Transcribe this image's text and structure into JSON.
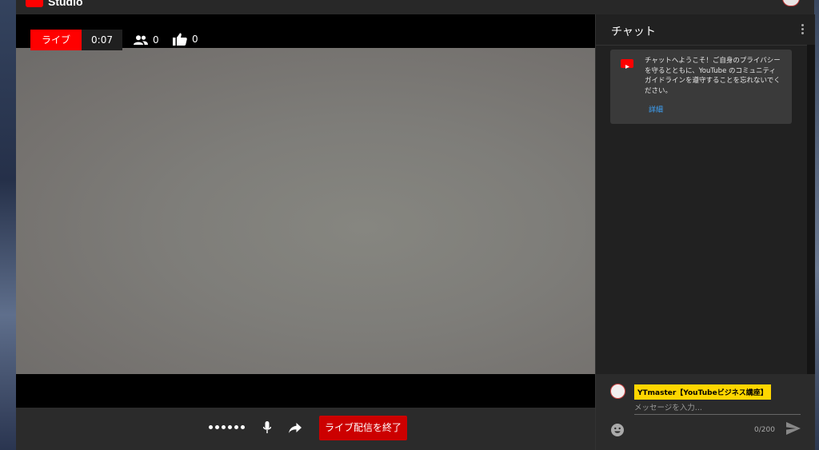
{
  "app": {
    "brand": "Studio"
  },
  "live": {
    "label": "ライブ",
    "time": "0:07",
    "viewers": "0",
    "likes": "0"
  },
  "controls": {
    "end_stream": "ライブ配信を終了"
  },
  "chat": {
    "title": "チャット",
    "welcome": "チャットへようこそ！ご自身のプライバシーを守るとともに、YouTube のコミュニティ ガイドラインを遵守することを忘れないでください。",
    "details_link": "詳細",
    "username": "YTmaster【YouTubeビジネス講座】",
    "input_placeholder": "メッセージを入力...",
    "char_count": "0/200"
  },
  "colors": {
    "accent": "#ff0000",
    "end_button": "#cc0000",
    "link": "#3ea6ff",
    "name_highlight": "#ffd600"
  },
  "icons": [
    "youtube-logo-icon",
    "viewers-icon",
    "like-icon",
    "mic-icon",
    "share-icon",
    "more-vert-icon",
    "emoji-icon",
    "send-icon"
  ]
}
